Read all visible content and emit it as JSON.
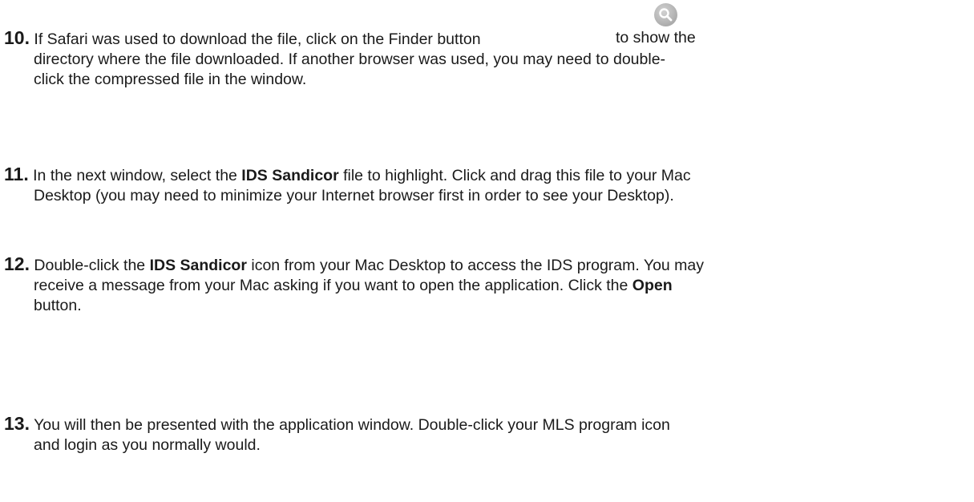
{
  "steps": [
    {
      "number": "10.",
      "line1_before_icon": "If Safari was used to download the file, click on the Finder button",
      "line1_after_icon": "to show the",
      "line2": "directory where the file downloaded.  If another browser was used, you may need to double-",
      "line3": "click the compressed file in the window."
    },
    {
      "number": "11.",
      "line1_a": "In the next window, select the ",
      "line1_bold": "IDS Sandicor",
      "line1_b": " file to highlight. Click and drag this file to your Mac",
      "line2": "Desktop (you may need to minimize your Internet browser first in order to see your Desktop)."
    },
    {
      "number": "12.",
      "line1_a": "Double-click the ",
      "line1_bold": "IDS Sandicor",
      "line1_b": " icon from your Mac Desktop to access the IDS program. You may",
      "line2_a": "receive a message from your Mac asking if you want to open the application. Click the ",
      "line2_bold": "Open",
      "line3": "button."
    },
    {
      "number": "13.",
      "line1": "You will then be presented with the application window. Double-click your MLS program icon",
      "line2": "and login as you normally would."
    }
  ],
  "icons": {
    "finder": "magnifier-icon"
  }
}
